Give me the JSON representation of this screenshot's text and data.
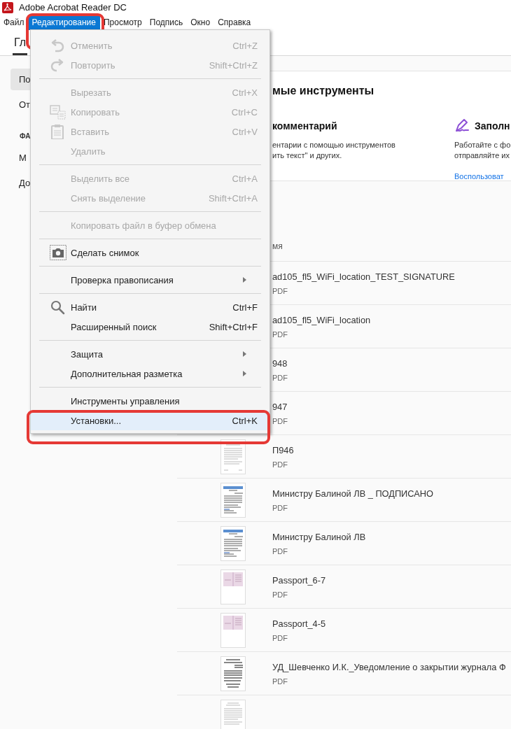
{
  "window": {
    "title": "Adobe Acrobat Reader DC"
  },
  "menubar": [
    {
      "label": "Файл",
      "selected": false,
      "annotated": false
    },
    {
      "label": "Редактирование",
      "selected": true,
      "annotated": true
    },
    {
      "label": "Просмотр",
      "selected": false,
      "annotated": false
    },
    {
      "label": "Подпись",
      "selected": false,
      "annotated": false
    },
    {
      "label": "Окно",
      "selected": false,
      "annotated": false
    },
    {
      "label": "Справка",
      "selected": false,
      "annotated": false
    }
  ],
  "tabs": [
    {
      "label": "Гл",
      "selected": true
    }
  ],
  "sidebar": {
    "items": [
      {
        "label": "По",
        "selected": true
      },
      {
        "label": "От",
        "selected": false
      }
    ],
    "section": "ФА",
    "section_items": [
      "М",
      "До"
    ]
  },
  "tools": {
    "title": "мые инструменты",
    "cards": [
      {
        "title": "комментарий",
        "icon": false,
        "description": [
          "ентарии с помощью инструментов",
          "ить текст\" и других."
        ]
      },
      {
        "title": "Заполн",
        "icon": true,
        "description": [
          "Работайте с фо",
          "отправляйте их"
        ],
        "link": "Воспользоват"
      }
    ]
  },
  "files": {
    "columns": [
      "мя"
    ],
    "rows": [
      {
        "name": "ad105_fl5_WiFi_location_TEST_SIGNATURE",
        "type": "PDF"
      },
      {
        "name": "ad105_fl5_WiFi_location",
        "type": "PDF"
      },
      {
        "name": "948",
        "type": "PDF"
      },
      {
        "name": "947",
        "type": "PDF"
      },
      {
        "name": "П946",
        "type": "PDF"
      },
      {
        "name": "Министру Балиной ЛВ _ ПОДПИСАНО",
        "type": "PDF"
      },
      {
        "name": "Министру Балиной ЛВ",
        "type": "PDF"
      },
      {
        "name": "Passport_6-7",
        "type": "PDF"
      },
      {
        "name": "Passport_4-5",
        "type": "PDF"
      },
      {
        "name": "УД_Шевченко И.К._Уведомление о закрытии журнала Ф",
        "type": "PDF"
      },
      {}
    ]
  },
  "menu": {
    "items": [
      {
        "kind": "item",
        "label": "Отменить",
        "shortcut": "Ctrl+Z",
        "disabled": true,
        "selected": false,
        "annotated": false
      },
      {
        "kind": "item",
        "label": "Повторить",
        "shortcut": "Shift+Ctrl+Z",
        "disabled": true,
        "selected": false,
        "annotated": false
      },
      {
        "kind": "separator"
      },
      {
        "kind": "item",
        "label": "Вырезать",
        "shortcut": "Ctrl+X",
        "disabled": true,
        "selected": false,
        "annotated": false
      },
      {
        "kind": "item",
        "label": "Копировать",
        "shortcut": "Ctrl+C",
        "disabled": true,
        "selected": false,
        "annotated": false
      },
      {
        "kind": "item",
        "label": "Вставить",
        "shortcut": "Ctrl+V",
        "disabled": true,
        "selected": false,
        "annotated": false
      },
      {
        "kind": "item",
        "label": "Удалить",
        "disabled": true,
        "selected": false,
        "annotated": false
      },
      {
        "kind": "separator"
      },
      {
        "kind": "item",
        "label": "Выделить все",
        "shortcut": "Ctrl+A",
        "disabled": true,
        "selected": false,
        "annotated": false
      },
      {
        "kind": "item",
        "label": "Снять выделение",
        "shortcut": "Shift+Ctrl+A",
        "disabled": true,
        "selected": false,
        "annotated": false
      },
      {
        "kind": "separator"
      },
      {
        "kind": "item",
        "label": "Копировать файл в буфер обмена",
        "disabled": true,
        "selected": false,
        "annotated": false
      },
      {
        "kind": "separator"
      },
      {
        "kind": "item",
        "label": "Сделать снимок",
        "disabled": false,
        "selected": false,
        "annotated": false
      },
      {
        "kind": "separator"
      },
      {
        "kind": "submenu",
        "label": "Проверка правописания",
        "disabled": false,
        "selected": false,
        "annotated": false
      },
      {
        "kind": "separator"
      },
      {
        "kind": "item",
        "label": "Найти",
        "shortcut": "Ctrl+F",
        "disabled": false,
        "selected": false,
        "annotated": false
      },
      {
        "kind": "item",
        "label": "Расширенный поиск",
        "shortcut": "Shift+Ctrl+F",
        "disabled": false,
        "selected": false,
        "annotated": false
      },
      {
        "kind": "separator"
      },
      {
        "kind": "submenu",
        "label": "Защита",
        "disabled": false,
        "selected": false,
        "annotated": false
      },
      {
        "kind": "submenu",
        "label": "Дополнительная разметка",
        "disabled": false,
        "selected": false,
        "annotated": false
      },
      {
        "kind": "separator"
      },
      {
        "kind": "item",
        "label": "Инструменты управления",
        "disabled": false,
        "selected": false,
        "annotated": false
      },
      {
        "kind": "item",
        "label": "Установки...",
        "shortcut": "Ctrl+K",
        "disabled": false,
        "selected": true,
        "annotated": true
      }
    ]
  }
}
